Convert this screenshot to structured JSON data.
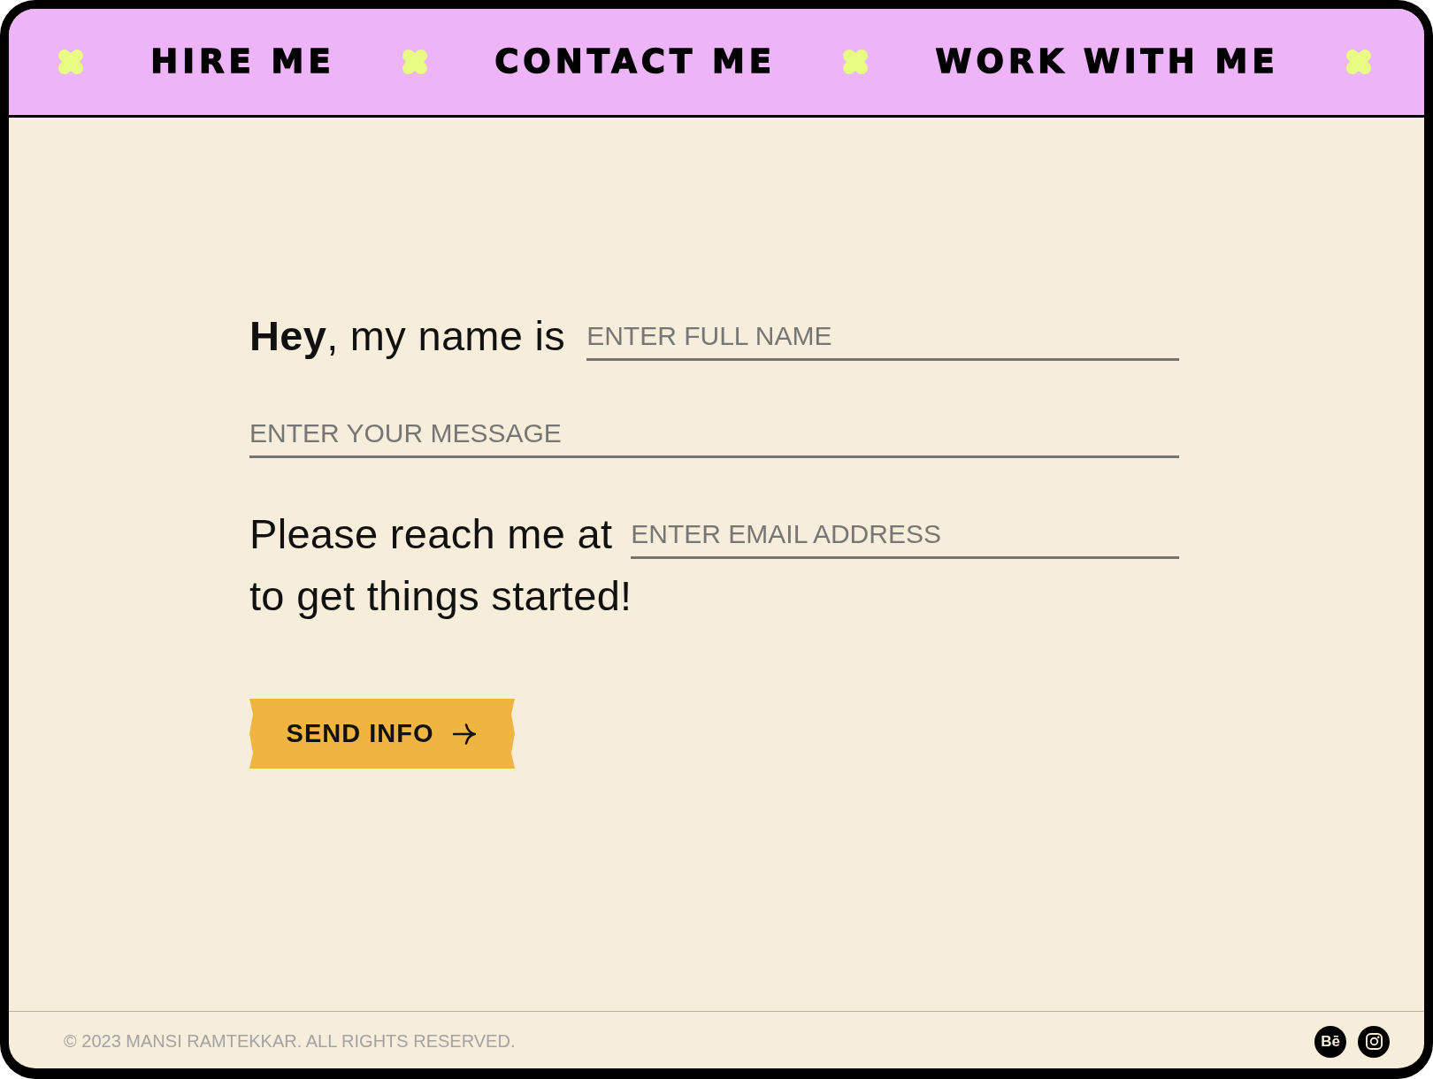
{
  "nav": {
    "items": [
      {
        "label": "HIRE ME"
      },
      {
        "label": "CONTACT ME"
      },
      {
        "label": "WORK WITH ME"
      }
    ]
  },
  "form": {
    "intro": "**Hey**, my name is",
    "name_field": {
      "placeholder": "ENTER FULL NAME"
    },
    "message_field": {
      "placeholder": "ENTER YOUR MESSAGE"
    },
    "reach_text": "Please reach me at",
    "email_field": {
      "placeholder": "ENTER EMAIL ADDRESS"
    },
    "closing_text": "to get things started!",
    "submit_button": {
      "label": "SEND INFO"
    }
  },
  "footer": {
    "copyright": "© 2023 MANSI RAMTEKKAR. ALL RIGHTS RESERVED.",
    "social_links": [
      {
        "kind": "letters",
        "label": "Bē"
      },
      {
        "kind": "camera"
      }
    ]
  }
}
